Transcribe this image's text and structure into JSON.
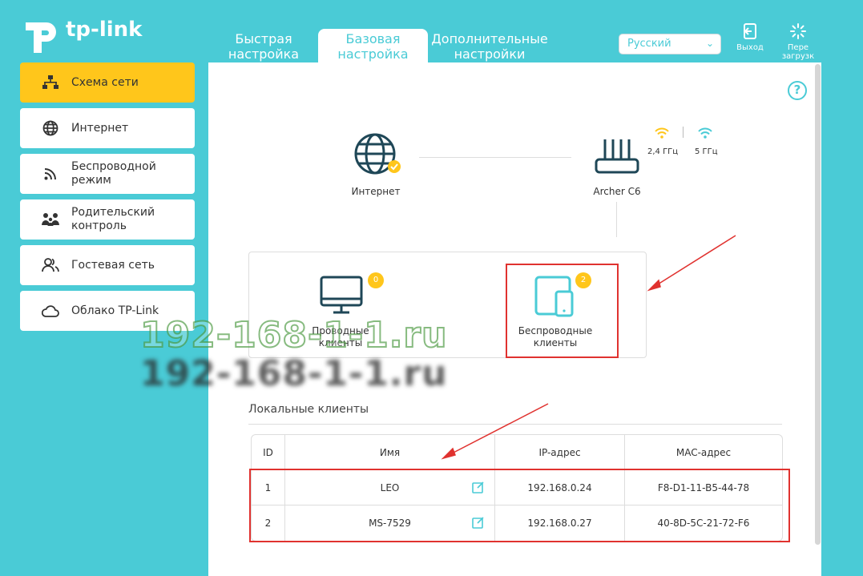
{
  "header": {
    "logo_text": "tp-link",
    "tabs": [
      {
        "line1": "Быстрая",
        "line2": "настройка"
      },
      {
        "line1": "Базовая",
        "line2": "настройка"
      },
      {
        "line1": "Дополнительные",
        "line2": "настройки"
      }
    ],
    "active_tab": 1,
    "language": "Русский",
    "logout_label": "Выход",
    "reboot_line1": "Пере",
    "reboot_line2": "загрузк"
  },
  "sidebar": {
    "items": [
      {
        "line1": "Схема сети",
        "line2": "",
        "icon": "network-map-icon"
      },
      {
        "line1": "Интернет",
        "line2": "",
        "icon": "globe-icon"
      },
      {
        "line1": "Беспроводной",
        "line2": "режим",
        "icon": "wifi-icon"
      },
      {
        "line1": "Родительский",
        "line2": "контроль",
        "icon": "parents-icon"
      },
      {
        "line1": "Гостевая сеть",
        "line2": "",
        "icon": "guests-icon"
      },
      {
        "line1": "Облако TP-Link",
        "line2": "",
        "icon": "cloud-icon"
      }
    ],
    "active_index": 0
  },
  "map": {
    "internet_label": "Интернет",
    "router_label": "Archer C6",
    "band_24": "2,4 ГГц",
    "band_5": "5 ГГц",
    "wired_count": "0",
    "wired_line1": "Проводные",
    "wired_line2": "клиенты",
    "wireless_count": "2",
    "wireless_line1": "Беспроводные",
    "wireless_line2": "клиенты"
  },
  "clients": {
    "title": "Локальные клиенты",
    "columns": [
      "ID",
      "Имя",
      "IP-адрес",
      "MAC-адрес"
    ],
    "rows": [
      {
        "id": "1",
        "name": "LEO",
        "ip": "192.168.0.24",
        "mac": "F8-D1-11-B5-44-78"
      },
      {
        "id": "2",
        "name": "MS-7529",
        "ip": "192.168.0.27",
        "mac": "40-8D-5C-21-72-F6"
      }
    ]
  },
  "watermark": "192-168-1-1.ru",
  "help_label": "?",
  "colors": {
    "accent": "#4acbd6",
    "active": "#ffc61b",
    "highlight": "#e0322f"
  }
}
